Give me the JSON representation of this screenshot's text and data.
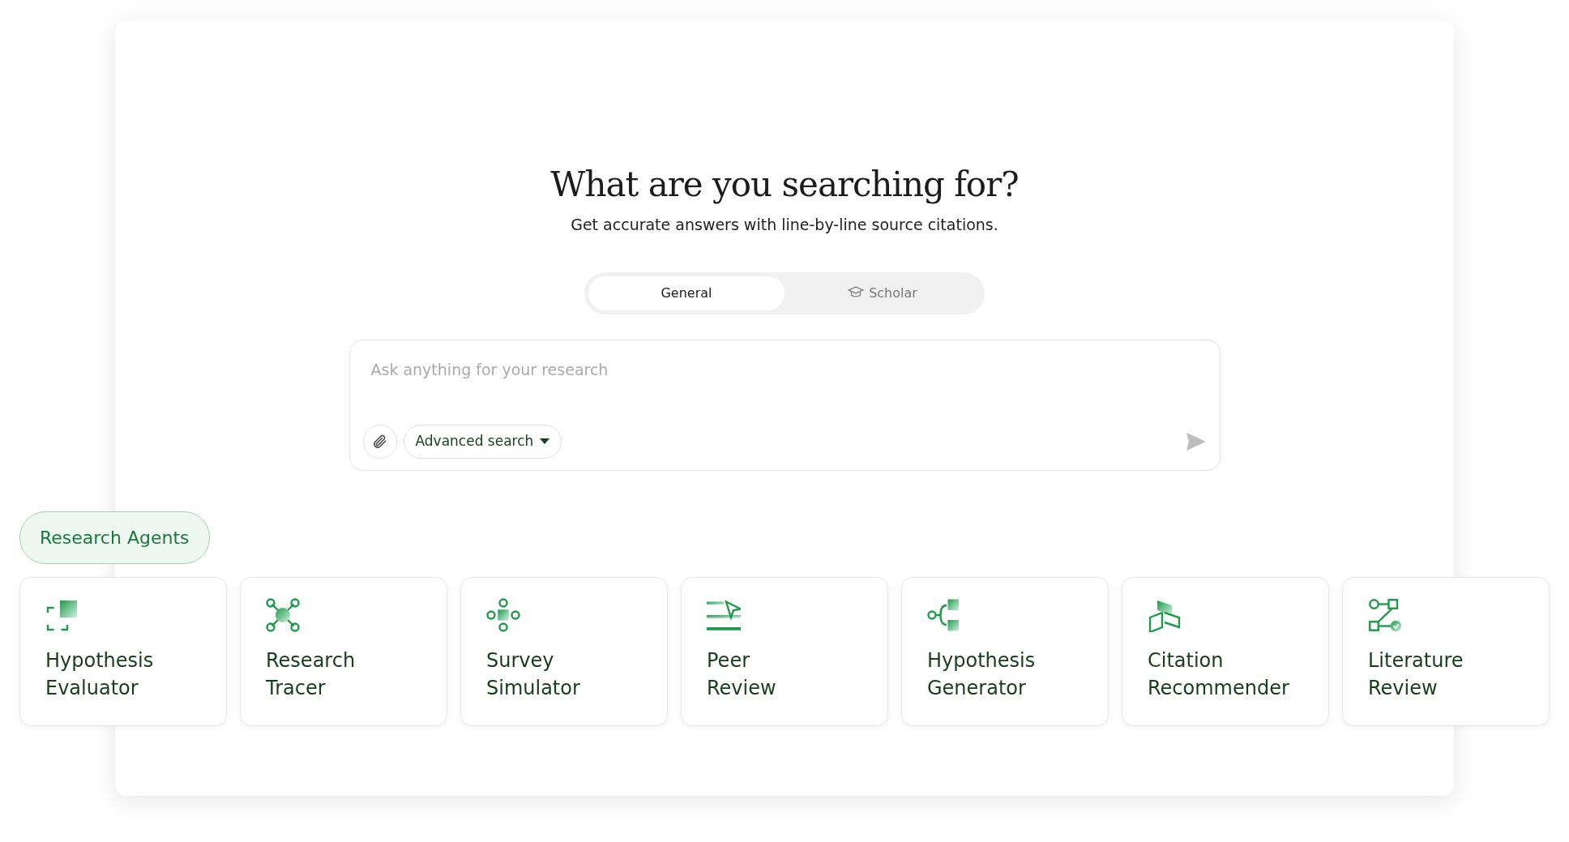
{
  "heading": "What are you searching for?",
  "subheading": "Get accurate answers with line-by-line source citations.",
  "tabs": [
    {
      "label": "General",
      "selected": true,
      "kind": "plain"
    },
    {
      "label": "Scholar",
      "selected": false,
      "kind": "scholar"
    }
  ],
  "search": {
    "placeholder": "Ask anything for your research",
    "advanced_label": "Advanced search"
  },
  "agents_label": "Research Agents",
  "agents": [
    {
      "kind": "evaluator",
      "title": "Hypothesis Evaluator"
    },
    {
      "kind": "tracer",
      "title": "Research Tracer"
    },
    {
      "kind": "survey",
      "title": "Survey Simulator"
    },
    {
      "kind": "peer",
      "title": "Peer Review"
    },
    {
      "kind": "generator",
      "title": "Hypothesis Generator"
    },
    {
      "kind": "citation",
      "title": "Citation Recommender"
    },
    {
      "kind": "literature",
      "title": "Literature Review"
    }
  ]
}
